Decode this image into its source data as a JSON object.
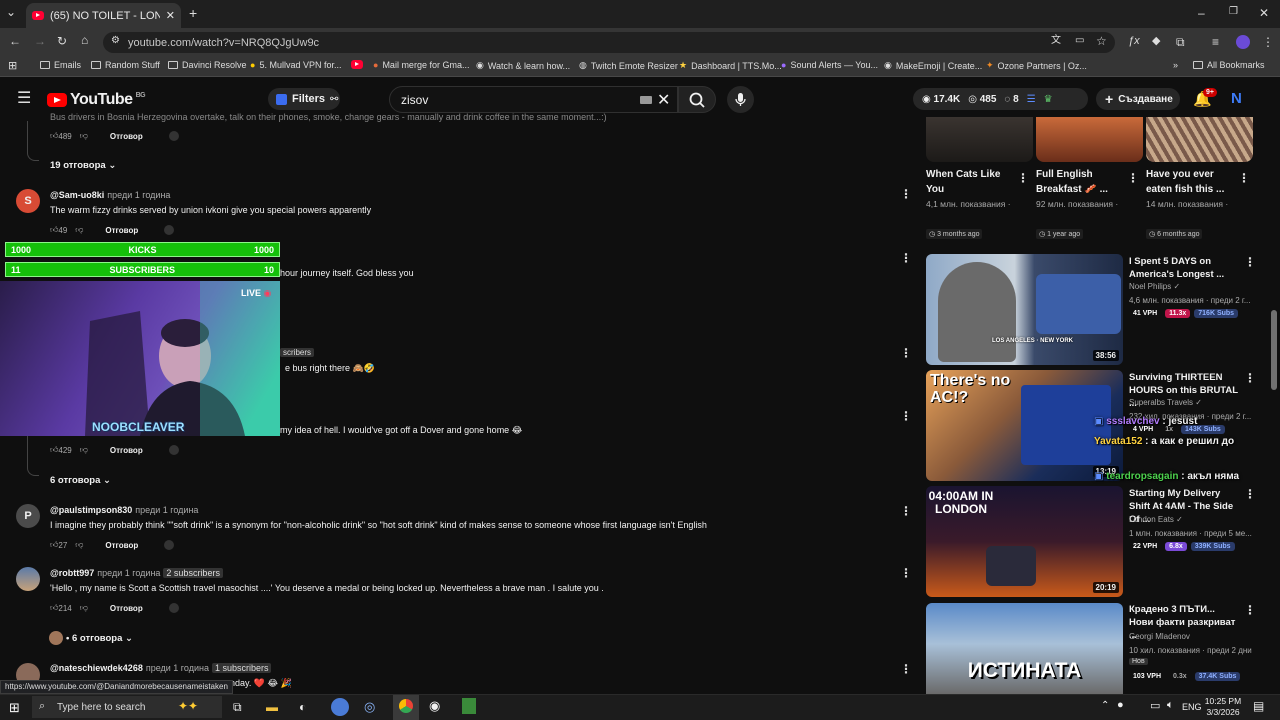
{
  "browser": {
    "tab_title": "(65) NO TOILET - LONGEST coa",
    "url": "youtube.com/watch?v=NRQ8QJgUw9c",
    "bookmarks": [
      "Emails",
      "Random Stuff",
      "Davinci Resolve",
      "5. Mullvad VPN for...",
      "Mail merge for Gma...",
      "Watch & learn how...",
      "Twitch Emote Resizer",
      "Dashboard | TTS.Mo...",
      "Sound Alerts — You...",
      "MakeEmoji | Create...",
      "Ozone Partners | Oz..."
    ],
    "all_bookmarks": "All Bookmarks",
    "status_url": "https://www.youtube.com/@Daniandmorebecausenameistaken"
  },
  "youtube": {
    "logo_text": "YouTube",
    "country": "BG",
    "filters_label": "Filters",
    "search_value": "zisov",
    "stats": {
      "views": "17.4K",
      "watching": "485",
      "count": "8"
    },
    "create_label": "Създаване",
    "notifications": "9+",
    "avatar_letter": "N"
  },
  "comments": {
    "c0": {
      "text": "Bus drivers in Bosnia Herzegovina overtake, talk on their phones, smoke, change gears - manually and drink coffee in the same moment...:)",
      "likes": "489",
      "reply": "Отговор"
    },
    "c0_replies": "19 отговора",
    "c1": {
      "avatar": "S",
      "author": "@Sam-uo8ki",
      "age": "преди 1 година",
      "text": "The warm fizzy drinks served by union ivkoni give you special powers apparently",
      "likes": "49",
      "reply": "Отговор"
    },
    "c2": {
      "text": "hour journey itself. God bless you"
    },
    "c3": {
      "badge": "scribers",
      "text": "e bus right there 🙈🤣"
    },
    "c4": {
      "text": "my idea of hell. I would've got off a Dover and gone home 😂",
      "likes": "429",
      "reply": "Отговор"
    },
    "c4_replies": "6 отговора",
    "c5": {
      "avatar": "P",
      "author": "@paulstimpson830",
      "age": "преди 1 година",
      "text": "I imagine they probably think \"\"soft drink\" is a synonym for \"non-alcoholic drink\" so \"hot soft drink\" kind of makes sense to someone whose first language isn't English",
      "likes": "27",
      "reply": "Отговор"
    },
    "c6": {
      "author": "@robtt997",
      "age": "преди 1 година",
      "badge": "2 subscribers",
      "text": "'Hello , my name is Scott a Scottish travel masochist ....' You deserve a medal or being locked up. Nevertheless a brave man . I salute you .",
      "likes": "214",
      "reply": "Отговор"
    },
    "c6_replies": "6 отговора",
    "c7": {
      "author": "@nateschiewdek4268",
      "age": "преди 1 година",
      "badge": "1 subscribers",
      "text": "nday. ❤️ 😂 🎉"
    }
  },
  "overlay": {
    "kicks": {
      "left": "1000",
      "label": "KICKS",
      "right": "1000"
    },
    "subs": {
      "left": "11",
      "label": "SUBSCRIBERS",
      "right": "10"
    },
    "live": "LIVE",
    "streamer": "NOOBCLEAVER"
  },
  "shorts": [
    {
      "title": "When Cats Like You",
      "views": "4,1 млн. показвания ·",
      "ago": "3 months ago"
    },
    {
      "title": "Full English Breakfast 🥓 ...",
      "views": "92 млн. показвания ·",
      "ago": "1 year ago"
    },
    {
      "title": "Have you ever eaten fish this ...",
      "views": "14 млн. показвания ·",
      "ago": "6 months ago"
    }
  ],
  "videos": [
    {
      "title": "I Spent 5 DAYS on America's Longest ...",
      "channel": "Noel Philips",
      "meta": "4,6 млн. показвания · преди 2 г...",
      "duration": "38:56",
      "vph": "41 VPH",
      "ratio": "11.3x",
      "subs": "716K Subs",
      "thumb_caption": "LOS ANGELES · NEW YORK"
    },
    {
      "title": "Surviving THIRTEEN HOURS on this BRUTAL ...",
      "channel": "Superalbs Travels",
      "meta": "232 хил. показвания · преди 2 г...",
      "duration": "13:19",
      "vph": "4 VPH",
      "ratio": "1x",
      "subs": "143K Subs",
      "thumb_caption": "There's no AC!?"
    },
    {
      "title": "Starting My Delivery Shift At 4AM - The Side Of ...",
      "channel": "London Eats",
      "meta": "1 млн. показвания · преди 5 ме...",
      "duration": "20:19",
      "vph": "22 VPH",
      "ratio": "6.8x",
      "subs": "339K Subs",
      "thumb_caption": "04:00AM IN LONDON"
    },
    {
      "title": "Крадено 3 ПЪТИ... Нови факти разкриват ...",
      "channel": "Georgi Mladenov",
      "meta": "10 хил. показвания · преди 2 дни",
      "badge": "Нов",
      "vph": "103 VPH",
      "ratio": "0.3x",
      "subs": "37.4K Subs",
      "thumb_caption": "ИСТИНАТА"
    }
  ],
  "chat": [
    {
      "user": "ssslavchev",
      "msg": " : jesust",
      "color": "#b47dff"
    },
    {
      "user": "Yavata152",
      "msg": " : а как е решил до",
      "color": "#ffd23f"
    },
    {
      "user": "teardropsagain",
      "msg": " : акъл няма",
      "color": "#4dd14d"
    }
  ],
  "taskbar": {
    "search_placeholder": "Type here to search",
    "lang": "ENG",
    "time": "10:25 PM",
    "date": "3/3/2026"
  }
}
